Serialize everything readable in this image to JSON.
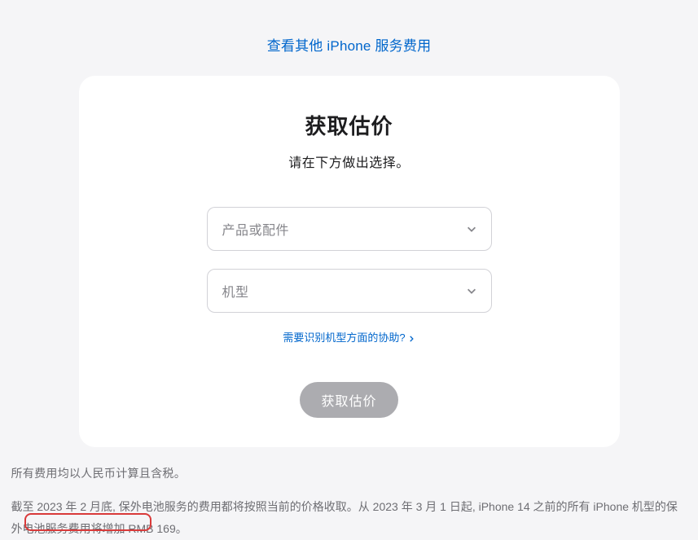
{
  "topLink": "查看其他 iPhone 服务费用",
  "card": {
    "title": "获取估价",
    "subtitle": "请在下方做出选择。",
    "select1": {
      "placeholder": "产品或配件"
    },
    "select2": {
      "placeholder": "机型"
    },
    "helpLink": "需要识别机型方面的协助?",
    "submitLabel": "获取估价"
  },
  "footer": {
    "note1": "所有费用均以人民币计算且含税。",
    "note2": "截至 2023 年 2 月底, 保外电池服务的费用都将按照当前的价格收取。从 2023 年 3 月 1 日起, iPhone 14 之前的所有 iPhone 机型的保外电池服务费用将增加 RMB 169。"
  }
}
